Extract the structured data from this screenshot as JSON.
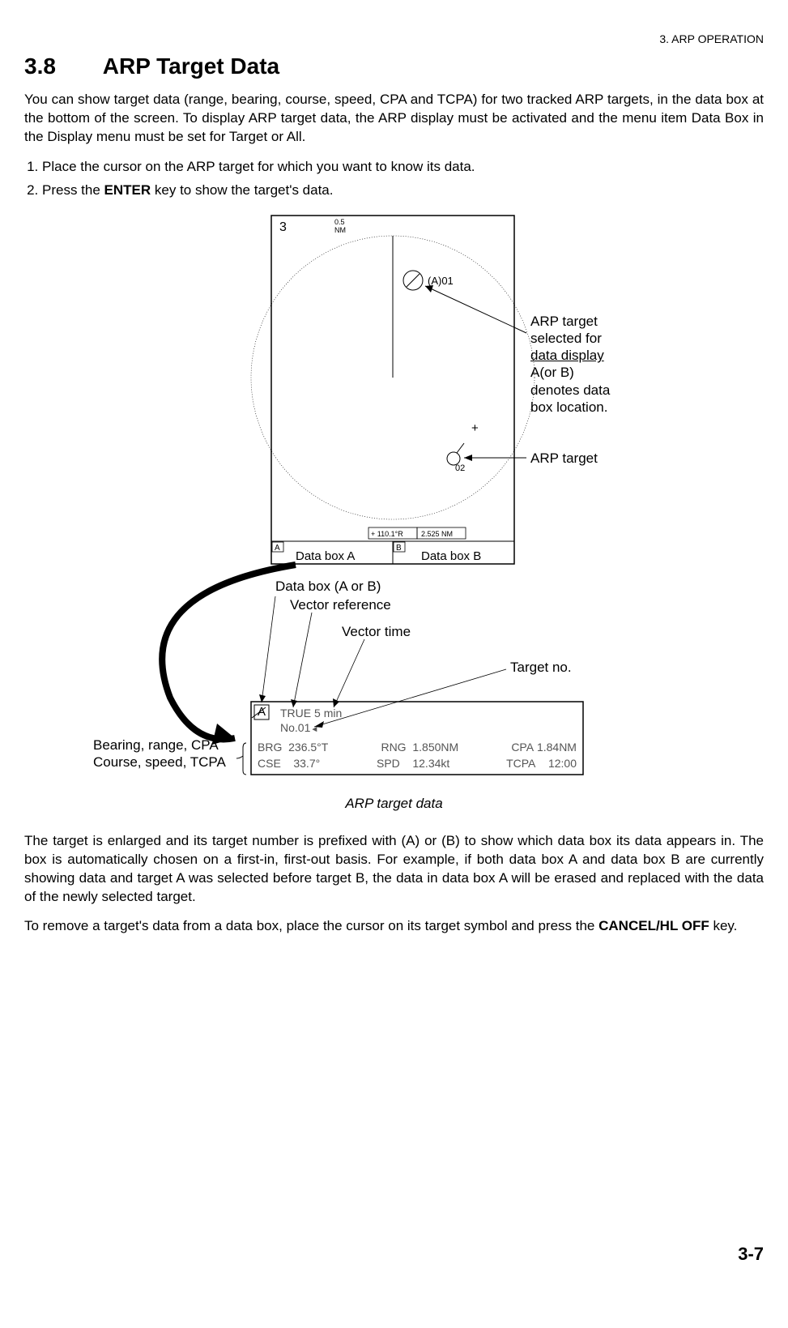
{
  "header": {
    "chapter": "3. ARP OPERATION",
    "section_num": "3.8",
    "section_title": "ARP Target Data"
  },
  "intro": "You can show target data (range, bearing, course, speed, CPA and TCPA) for two tracked ARP targets, in the data box at the bottom of the screen. To display ARP target data, the ARP display must be activated and the menu item Data Box in the Display menu must be set for Target or All.",
  "steps": {
    "s1": "Place the cursor on the ARP target for which you want to know its data.",
    "s2_a": "Press the ",
    "s2_key": "ENTER",
    "s2_b": " key to show the target's data."
  },
  "figure": {
    "range_scale": "3",
    "range_val": "0.5",
    "range_unit": "NM",
    "target_a": "(A)01",
    "target_b": "02",
    "cursor_brg": "+ 110.1°R",
    "cursor_rng": "2.525 NM",
    "box_a_label": "A",
    "box_b_label": "B",
    "box_a_text": "Data box A",
    "box_b_text": "Data box B",
    "annot_selected_1": "ARP target",
    "annot_selected_2": "selected for",
    "annot_selected_3": "data display",
    "annot_selected_4a": "A(or B)",
    "annot_selected_4b": "denotes data",
    "annot_selected_4c": "box location.",
    "annot_arp_target": "ARP target",
    "annot_databox": "Data box (A or B)",
    "annot_vecref": "Vector reference",
    "annot_vectime": "Vector time",
    "annot_targetno": "Target no.",
    "annot_brc": "Bearing, range, CPA",
    "annot_cst": "Course, speed, TCPA",
    "databox": {
      "id": "A",
      "vec_ref": "TRUE",
      "vec_time": "5 min",
      "target_no": "No.01",
      "row1": {
        "brg_l": "BRG",
        "brg_v": "236.5°T",
        "rng_l": "RNG",
        "rng_v": "1.850NM",
        "cpa_l": "CPA",
        "cpa_v": "1.84NM"
      },
      "row2": {
        "cse_l": "CSE",
        "cse_v": "33.7°",
        "spd_l": "SPD",
        "spd_v": "12.34kt",
        "tcpa_l": "TCPA",
        "tcpa_v": "12:00"
      }
    },
    "caption": "ARP target data"
  },
  "para2": "The target is enlarged and its target number is prefixed with (A) or (B) to show which data box its data appears in. The box is automatically chosen on a first-in, first-out basis. For example, if both data box A and data box B are currently showing data and target A was selected before target B, the data in data box A will be erased and replaced with the data of the newly selected target.",
  "para3_a": "To remove a target's data from a data box, place the cursor on its target symbol and press the ",
  "para3_key": "CANCEL/HL OFF",
  "para3_b": " key.",
  "footer": "3-7"
}
